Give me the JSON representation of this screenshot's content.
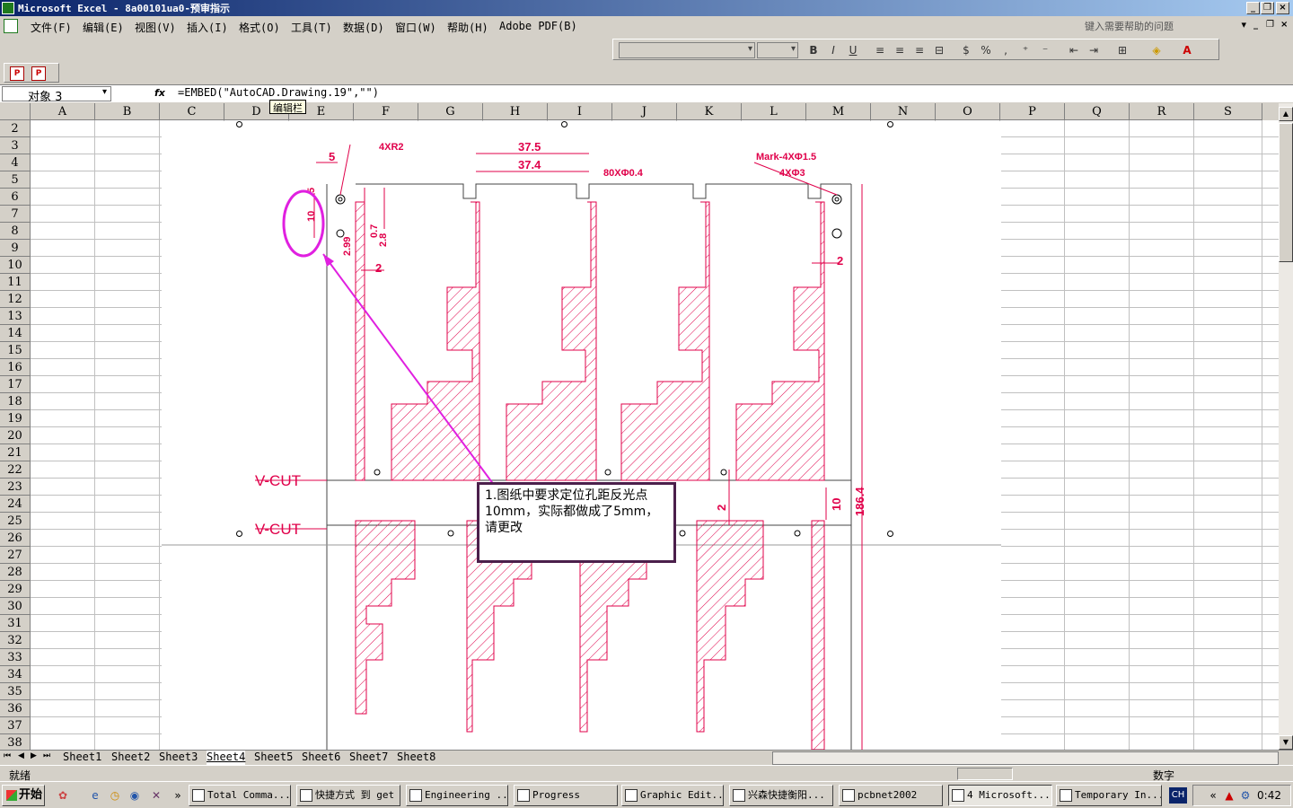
{
  "window": {
    "title": "Microsoft Excel - 8a00101ua0-预审指示"
  },
  "menu": [
    "文件(F)",
    "编辑(E)",
    "视图(V)",
    "插入(I)",
    "格式(O)",
    "工具(T)",
    "数据(D)",
    "窗口(W)",
    "帮助(H)",
    "Adobe PDF(B)"
  ],
  "help_placeholder": "键入需要帮助的问题",
  "formula": {
    "name_box": "对象 3",
    "fx": "fx",
    "content": "=EMBED(\"AutoCAD.Drawing.19\",\"\")",
    "tooltip": "编辑栏"
  },
  "columns": [
    "A",
    "B",
    "C",
    "D",
    "E",
    "F",
    "G",
    "H",
    "I",
    "J",
    "K",
    "L",
    "M",
    "N",
    "O",
    "P",
    "Q",
    "R",
    "S"
  ],
  "rows": [
    "2",
    "3",
    "4",
    "5",
    "6",
    "7",
    "8",
    "9",
    "10",
    "11",
    "12",
    "13",
    "14",
    "15",
    "16",
    "17",
    "18",
    "19",
    "20",
    "21",
    "22",
    "23",
    "24",
    "25",
    "26",
    "27",
    "28",
    "29",
    "30",
    "31",
    "32",
    "33",
    "34",
    "35",
    "36",
    "37",
    "38"
  ],
  "drawing": {
    "dims": {
      "d5": "5",
      "r": "4XR2",
      "d375": "37.5",
      "d374": "37.4",
      "holes": "80XΦ0.4",
      "mark": "Mark-4XΦ1.5",
      "phi3": "4XΦ3",
      "d5v": "5",
      "d10": "10",
      "d07": "0.7",
      "d28": "2.8",
      "d299": "2.99",
      "d2a": "2",
      "d2b": "2",
      "d2c": "2",
      "d10b": "10",
      "d1864": "186.4"
    },
    "vcut1": "V-CUT",
    "vcut2": "V-CUT"
  },
  "callout": {
    "text": "1.图纸中要求定位孔距反光点10mm，实际都做成了5mm，请更改"
  },
  "sheets": [
    "Sheet1",
    "Sheet2",
    "Sheet3",
    "Sheet4",
    "Sheet5",
    "Sheet6",
    "Sheet7",
    "Sheet8"
  ],
  "active_sheet": "Sheet4",
  "status": {
    "left": "就绪",
    "mode": "数字"
  },
  "taskbar": {
    "start": "开始",
    "tasks": [
      "Total Comma...",
      "快捷方式 到 get",
      "Engineering ...",
      "Progress",
      "Graphic Edit...",
      "兴森快捷衡阳...",
      "pcbnet2002",
      "4 Microsoft...",
      "Temporary In..."
    ],
    "lang": "CH",
    "clock": "0:42"
  },
  "colors": {
    "accent": "#0a246a",
    "drawing_red": "#e0004a",
    "annotation": "#e020e0"
  }
}
